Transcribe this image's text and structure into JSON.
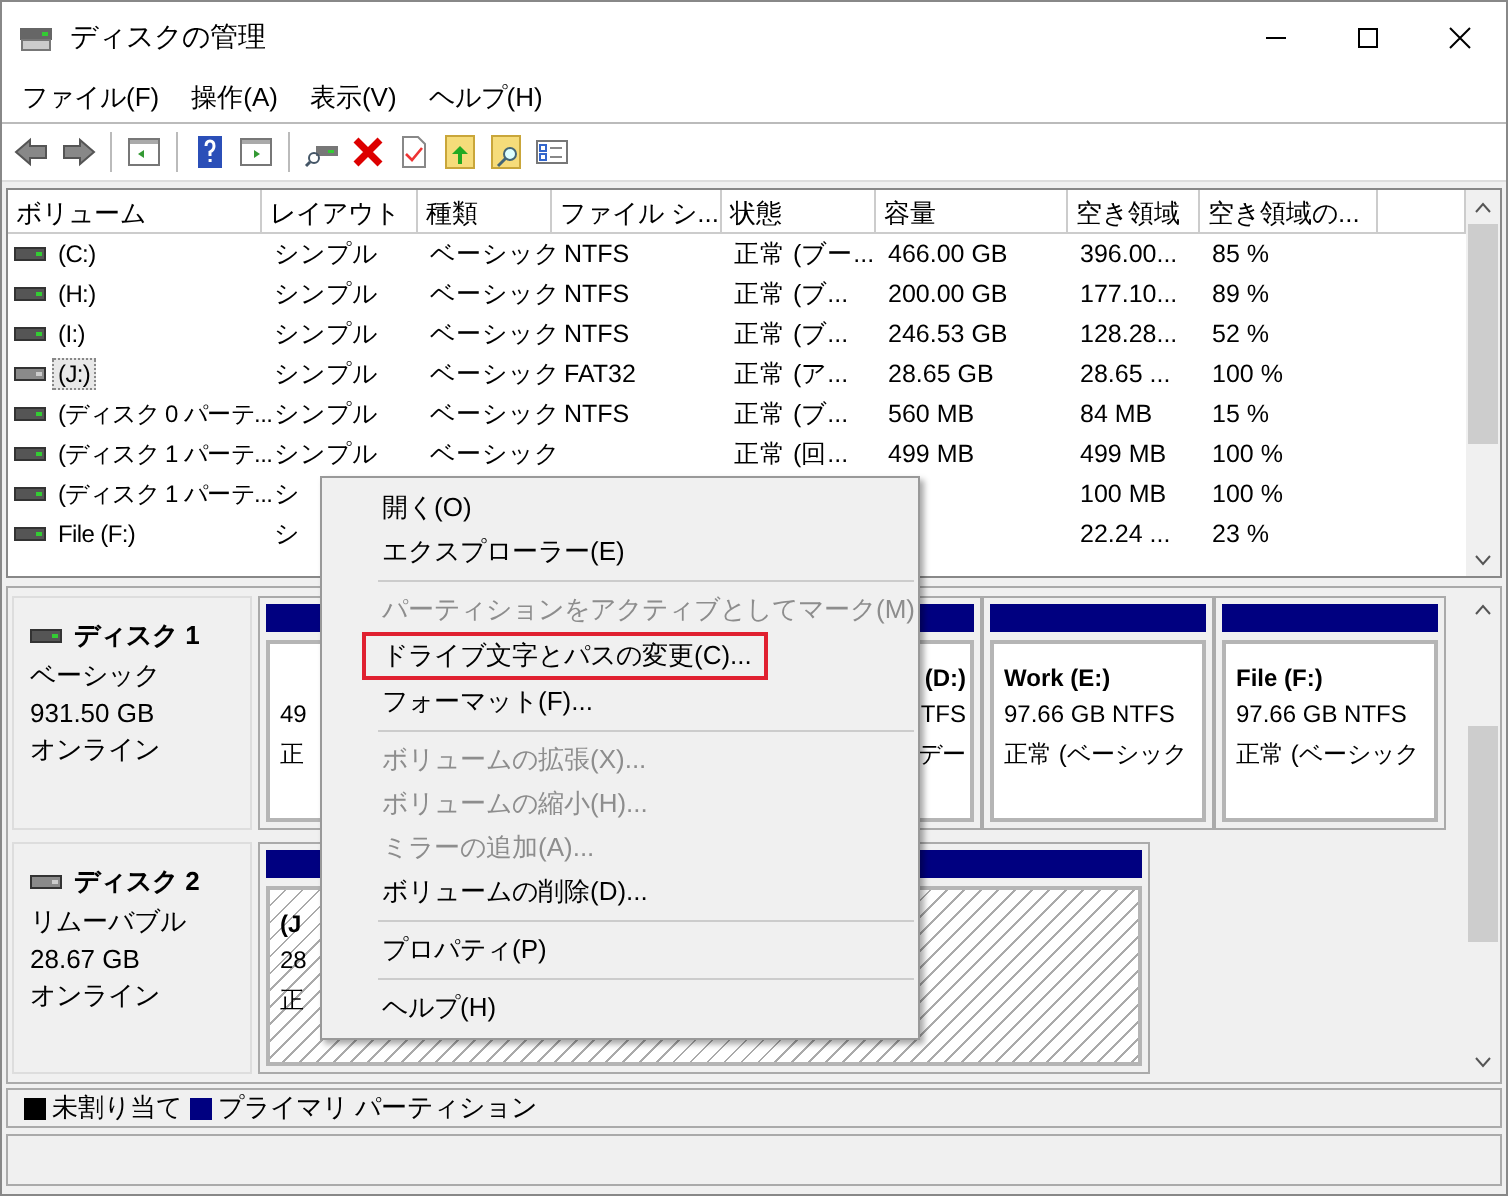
{
  "window": {
    "title": "ディスクの管理"
  },
  "menu": [
    "ファイル(F)",
    "操作(A)",
    "表示(V)",
    "ヘルプ(H)"
  ],
  "volume_list": {
    "columns": [
      "ボリューム",
      "レイアウト",
      "種類",
      "ファイル シ...",
      "状態",
      "容量",
      "空き領域",
      "空き領域の..."
    ],
    "rows": [
      {
        "focused": false,
        "cells": [
          "(C:)",
          "シンプル",
          "ベーシック",
          "NTFS",
          "正常 (ブー...",
          "466.00 GB",
          "396.00...",
          "85 %"
        ]
      },
      {
        "focused": false,
        "cells": [
          "(H:)",
          "シンプル",
          "ベーシック",
          "NTFS",
          "正常 (ブ...",
          "200.00 GB",
          "177.10...",
          "89 %"
        ]
      },
      {
        "focused": false,
        "cells": [
          "(I:)",
          "シンプル",
          "ベーシック",
          "NTFS",
          "正常 (ブ...",
          "246.53 GB",
          "128.28...",
          "52 %"
        ]
      },
      {
        "focused": true,
        "cells": [
          "(J:)",
          "シンプル",
          "ベーシック",
          "FAT32",
          "正常 (ア...",
          "28.65 GB",
          "28.65 ...",
          "100 %"
        ]
      },
      {
        "focused": false,
        "cells": [
          "(ディスク 0 パーテ...",
          "シンプル",
          "ベーシック",
          "NTFS",
          "正常 (ブ...",
          "560 MB",
          "84 MB",
          "15 %"
        ]
      },
      {
        "focused": false,
        "cells": [
          "(ディスク 1 パーテ...",
          "シンプル",
          "ベーシック",
          null,
          "正常 (回...",
          "499 MB",
          "499 MB",
          "100 %"
        ]
      },
      {
        "focused": false,
        "cells": [
          "(ディスク 1 パーテ...",
          "シ",
          null,
          null,
          null,
          null,
          "100 MB",
          "100 %"
        ]
      },
      {
        "focused": false,
        "cells": [
          "File (F:)",
          "シ",
          null,
          null,
          null,
          null,
          "22.24 ...",
          "23 %"
        ]
      }
    ]
  },
  "disks": [
    {
      "name": "ディスク 1",
      "type": "ベーシック",
      "size": "931.50 GB",
      "status": "オンライン",
      "removable": false,
      "partitions": [
        {
          "selected": false,
          "overlapped": false,
          "lines": [
            "49",
            "正"
          ]
        },
        {
          "selected": false,
          "overlapped": true,
          "title": "(D:)",
          "lines": [
            "TFS",
            "デー"
          ]
        },
        {
          "selected": false,
          "overlapped": false,
          "title": "Work  (E:)",
          "lines": [
            "97.66 GB NTFS",
            "正常 (ベーシック"
          ]
        },
        {
          "selected": false,
          "overlapped": false,
          "title": "File  (F:)",
          "lines": [
            "97.66 GB NTFS",
            "正常 (ベーシック"
          ]
        }
      ]
    },
    {
      "name": "ディスク 2",
      "type": "リムーバブル",
      "size": "28.67 GB",
      "status": "オンライン",
      "removable": true,
      "partitions": [
        {
          "selected": true,
          "overlapped": false,
          "title": "(J",
          "lines": [
            "28",
            "正"
          ]
        }
      ]
    }
  ],
  "legend": [
    {
      "label": "未割り当て",
      "color": "#000000"
    },
    {
      "label": "プライマリ パーティション",
      "color": "#000080"
    }
  ],
  "context_menu": [
    {
      "kind": "item",
      "label": "開く(O)",
      "disabled": false,
      "highlighted": false
    },
    {
      "kind": "item",
      "label": "エクスプローラー(E)",
      "disabled": false,
      "highlighted": false
    },
    {
      "kind": "separator"
    },
    {
      "kind": "item",
      "label": "パーティションをアクティブとしてマーク(M)",
      "disabled": true,
      "highlighted": false
    },
    {
      "kind": "item",
      "label": "ドライブ文字とパスの変更(C)...",
      "disabled": false,
      "highlighted": true
    },
    {
      "kind": "item",
      "label": "フォーマット(F)...",
      "disabled": false,
      "highlighted": false
    },
    {
      "kind": "separator"
    },
    {
      "kind": "item",
      "label": "ボリュームの拡張(X)...",
      "disabled": true,
      "highlighted": false
    },
    {
      "kind": "item",
      "label": "ボリュームの縮小(H)...",
      "disabled": true,
      "highlighted": false
    },
    {
      "kind": "item",
      "label": "ミラーの追加(A)...",
      "disabled": true,
      "highlighted": false
    },
    {
      "kind": "item",
      "label": "ボリュームの削除(D)...",
      "disabled": false,
      "highlighted": false
    },
    {
      "kind": "separator"
    },
    {
      "kind": "item",
      "label": "プロパティ(P)",
      "disabled": false,
      "highlighted": false
    },
    {
      "kind": "separator"
    },
    {
      "kind": "item",
      "label": "ヘルプ(H)",
      "disabled": false,
      "highlighted": false
    }
  ]
}
